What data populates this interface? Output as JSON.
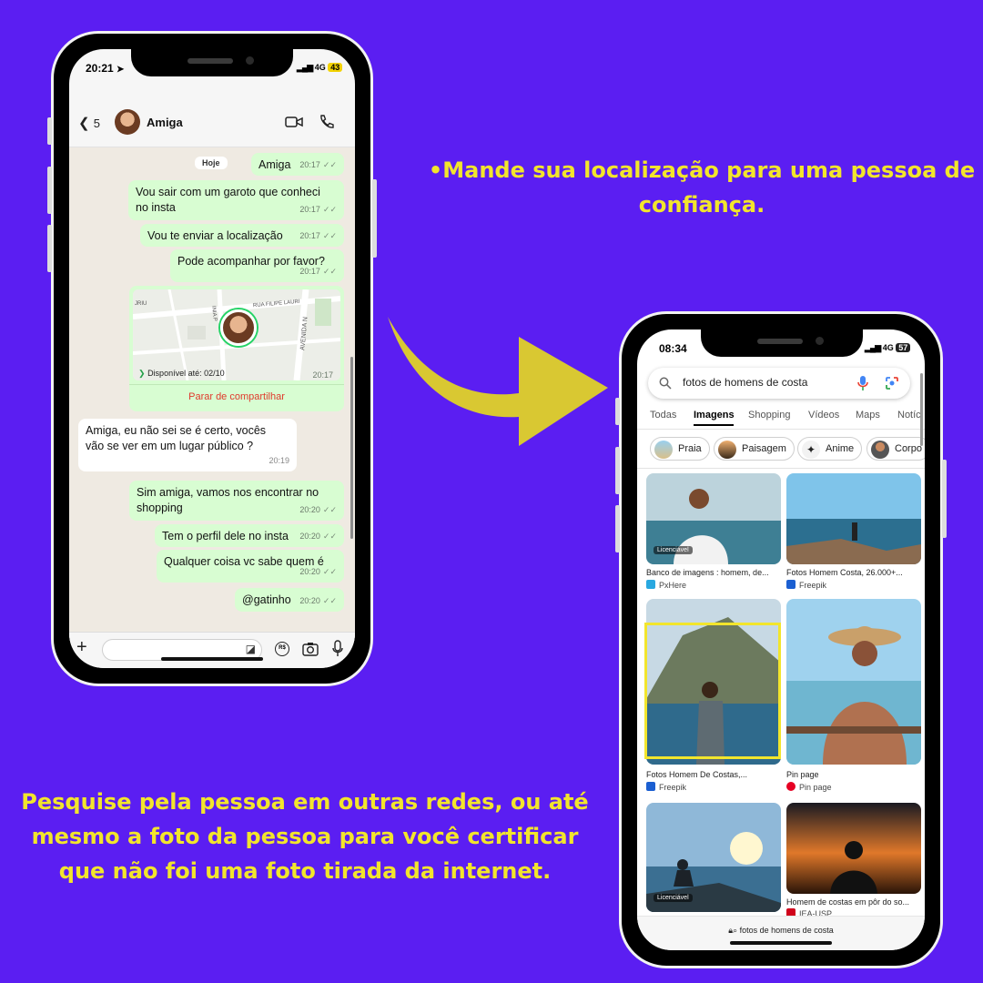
{
  "captions": {
    "top_line1": "•Mande sua localização para uma pessoa de",
    "top_line2": "confiança.",
    "bottom_line1": "Pesquise pela pessoa em outras redes, ou até",
    "bottom_line2": "mesmo a foto da pessoa para você certificar",
    "bottom_line3": "que não foi uma foto tirada da internet."
  },
  "colors": {
    "background": "#5b1ef2",
    "caption": "#f2e52c",
    "arrow": "#d9c832",
    "bubble_out": "#d8fdd2",
    "highlight": "#f2e52c"
  },
  "chat": {
    "status_time": "20:21",
    "network": "4G",
    "battery": "43",
    "back_count": "5",
    "contact_name": "Amiga",
    "date_chip": "Hoje",
    "messages": [
      {
        "text": "Amiga",
        "time": "20:17"
      },
      {
        "text": "Vou sair com um garoto que conheci",
        "text2": "no insta",
        "time": "20:17"
      },
      {
        "text": "Vou te enviar a localização",
        "time": "20:17"
      },
      {
        "text": "Pode acompanhar por favor?",
        "time": "20:17"
      },
      {
        "text": "Amiga, eu não sei se é certo, vocês",
        "text2": "vão se ver em um lugar público ?",
        "time": "20:19"
      },
      {
        "text": "Sim amiga, vamos nos encontrar no",
        "text2": "shopping",
        "time": "20:20"
      },
      {
        "text": "Tem o perfil dele no insta",
        "time": "20:20"
      },
      {
        "text": "Qualquer coisa vc sabe quem é",
        "time": "20:20"
      },
      {
        "text": "@gatinho",
        "time": "20:20"
      }
    ],
    "location": {
      "available_until": "Disponível até: 02/10",
      "time": "20:17",
      "stop_sharing": "Parar de compartilhar",
      "street1": "RUA FILIPE LAURI",
      "street2": "AVENIDA N",
      "street3": "JRIU",
      "street4": "INIA P"
    }
  },
  "browser": {
    "status_time": "08:34",
    "network": "4G",
    "battery": "57",
    "query": "fotos de homens de costa",
    "tabs": [
      "Todas",
      "Imagens",
      "Shopping",
      "Vídeos",
      "Maps",
      "Notíc"
    ],
    "chips": [
      "Praia",
      "Paisagem",
      "Anime",
      "Corpo"
    ],
    "results": [
      {
        "title": "Banco de imagens : homem, de...",
        "source": "PxHere",
        "licensed": "Licenciável"
      },
      {
        "title": "Fotos Homem Costa, 26.000+...",
        "source": "Freepik"
      },
      {
        "title": "Fotos Homem De Costas,...",
        "source": "Freepik"
      },
      {
        "title": "Pin page",
        "source": "Pin page"
      },
      {
        "title": "",
        "source": "",
        "licensed": "Licenciável"
      },
      {
        "title": "Homem de costas em pôr do so...",
        "source": "IEA-USP"
      }
    ],
    "url": "fotos de homens de costa"
  }
}
